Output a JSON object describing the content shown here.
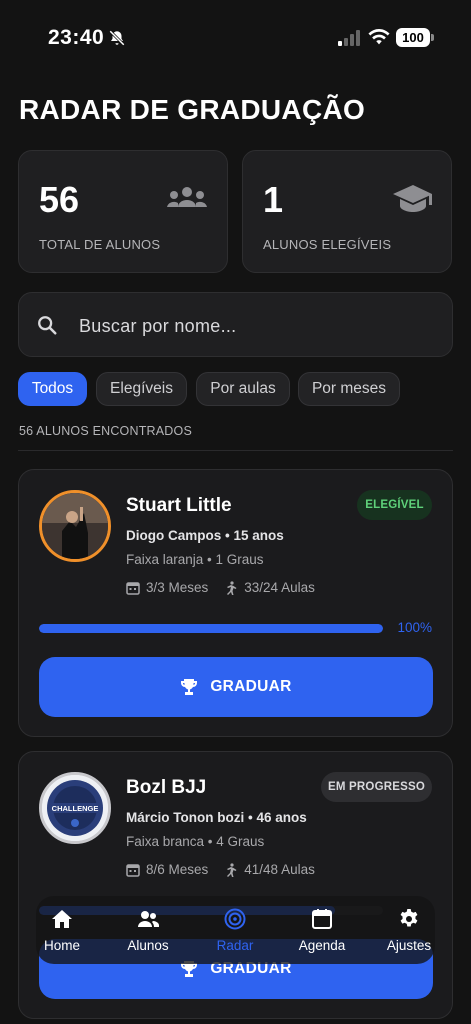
{
  "status_bar": {
    "time": "23:40",
    "battery": "100"
  },
  "page": {
    "title": "RADAR DE GRADUAÇÃO"
  },
  "stats": [
    {
      "value": "56",
      "label": "TOTAL DE ALUNOS",
      "icon": "users-icon"
    },
    {
      "value": "1",
      "label": "ALUNOS ELEGÍVEIS",
      "icon": "graduation-cap-icon"
    }
  ],
  "search": {
    "placeholder": "Buscar por nome..."
  },
  "filters": [
    {
      "label": "Todos",
      "active": true
    },
    {
      "label": "Elegíveis",
      "active": false
    },
    {
      "label": "Por aulas",
      "active": false
    },
    {
      "label": "Por meses",
      "active": false
    }
  ],
  "results_count": "56 ALUNOS ENCONTRADOS",
  "students": [
    {
      "name": "Stuart Little",
      "badge": "ELEGÍVEL",
      "meta": "Diogo Campos • 15 anos",
      "belt": "Faixa laranja • 1 Graus",
      "months": "3/3 Meses",
      "classes": "33/24 Aulas",
      "progress": 100,
      "progress_label": "100%",
      "button_label": "GRADUAR"
    },
    {
      "name": "Bozl BJJ",
      "badge": "EM PROGRESSO",
      "meta": "Márcio Tonon bozi • 46 anos",
      "belt": "Faixa branca • 4 Graus",
      "months": "8/6 Meses",
      "classes": "41/48 Aulas",
      "button_label": "GRADUAR",
      "avatar_text": "CHALLENGE"
    }
  ],
  "nav": [
    {
      "label": "Home",
      "icon": "home-icon",
      "active": false
    },
    {
      "label": "Alunos",
      "icon": "users-icon",
      "active": false
    },
    {
      "label": "Radar",
      "icon": "radar-icon",
      "active": true
    },
    {
      "label": "Agenda",
      "icon": "calendar-icon",
      "active": false
    },
    {
      "label": "Ajustes",
      "icon": "gear-icon",
      "active": false
    }
  ],
  "colors": {
    "accent": "#2f63f0",
    "eligible": "#5fd17a",
    "avatar_ring_orange": "#f0902a"
  }
}
